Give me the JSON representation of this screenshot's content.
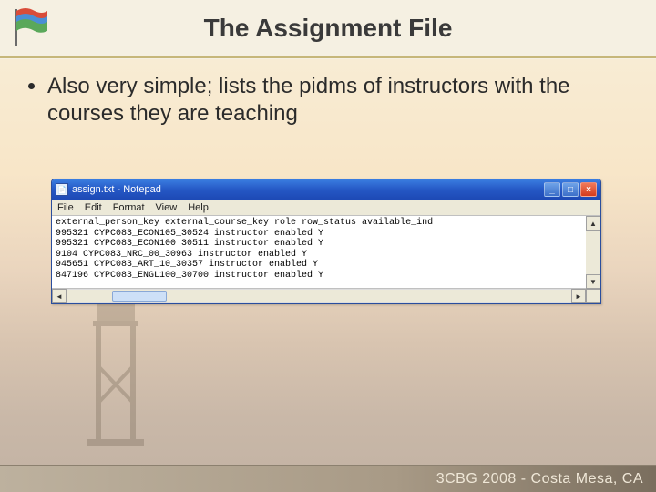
{
  "title": "The Assignment File",
  "bullet": "Also very simple; lists the pidms of instructors with the courses they are teaching",
  "notepad": {
    "title": "assign.txt - Notepad",
    "menus": [
      "File",
      "Edit",
      "Format",
      "View",
      "Help"
    ],
    "lines": [
      "external_person_key external_course_key role row_status available_ind",
      "995321 CYPC083_ECON105_30524 instructor enabled Y",
      "995321 CYPC083_ECON100 30511 instructor enabled Y",
      "9104 CYPC083_NRC_00_30963 instructor enabled Y",
      "945651 CYPC083_ART_10_30357 instructor enabled Y",
      "847196 CYPC083_ENGL100_30700 instructor enabled Y"
    ]
  },
  "controls": {
    "min": "_",
    "max": "□",
    "close": "×"
  },
  "scroll": {
    "left": "◄",
    "right": "►",
    "up": "▲",
    "down": "▼"
  },
  "footer": "3CBG 2008 - Costa Mesa, CA"
}
